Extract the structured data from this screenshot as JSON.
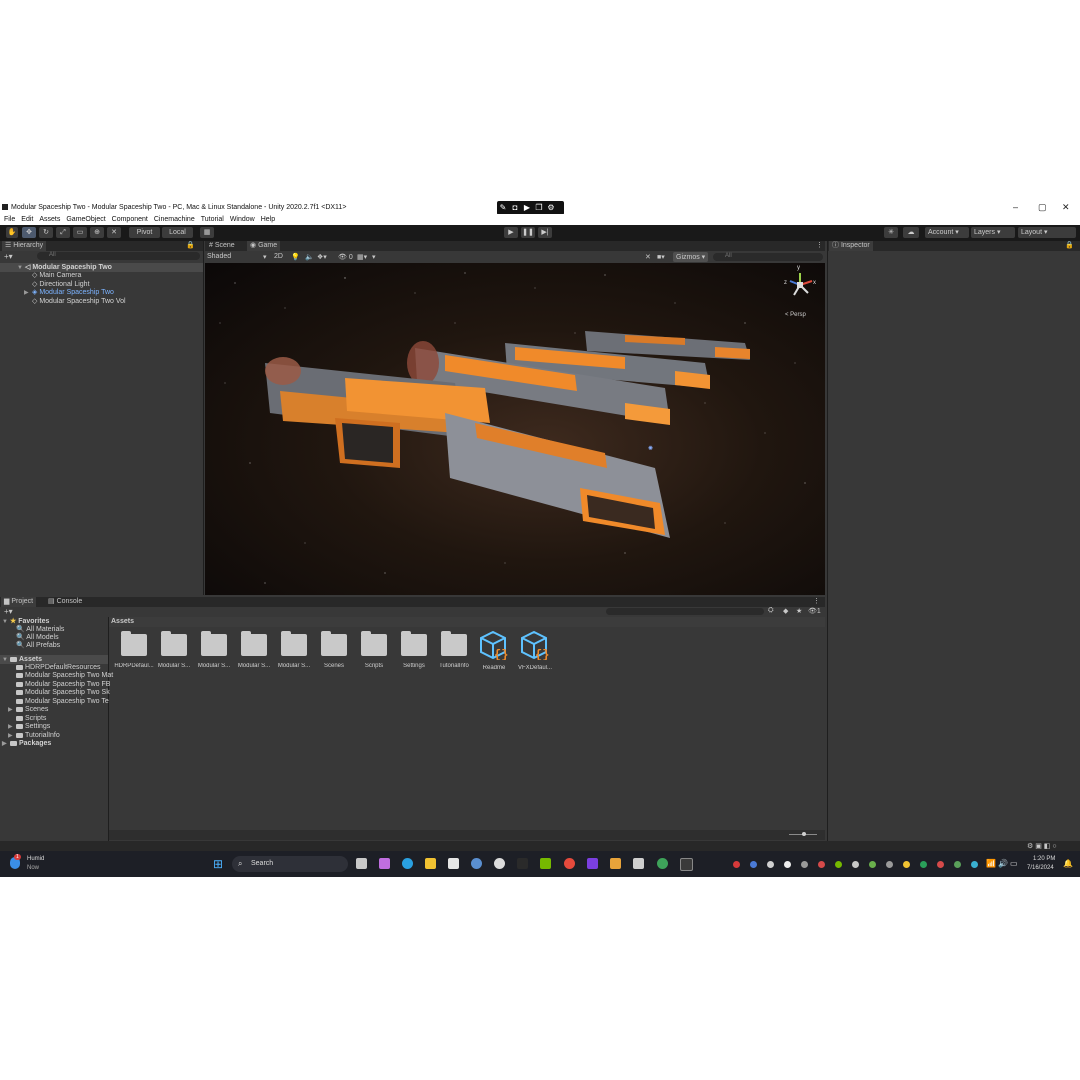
{
  "titlebar": {
    "title": "Modular Spaceship Two - Modular Spaceship Two - PC, Mac & Linux Standalone - Unity 2020.2.7f1 <DX11>"
  },
  "capture_bar": {
    "icons": [
      "pen-icon",
      "camera-icon",
      "video-icon",
      "copy-icon",
      "settings-icon"
    ]
  },
  "window_controls": {
    "minimize": "–",
    "maximize": "▢",
    "close": "✕"
  },
  "menu": {
    "items": [
      "File",
      "Edit",
      "Assets",
      "GameObject",
      "Component",
      "Cinemachine",
      "Tutorial",
      "Window",
      "Help"
    ]
  },
  "toolbar": {
    "pivot": "Pivot",
    "local": "Local",
    "account": "Account",
    "layers": "Layers",
    "layout": "Layout"
  },
  "hierarchy": {
    "tab": "Hierarchy",
    "search_placeholder": "All",
    "items": [
      {
        "label": "Modular Spaceship Two"
      },
      {
        "label": "Main Camera"
      },
      {
        "label": "Directional Light"
      },
      {
        "label": "Modular Spaceship Two"
      },
      {
        "label": "Modular Spaceship Two Vol"
      }
    ]
  },
  "scene": {
    "tab_scene": "Scene",
    "tab_game": "Game",
    "shading": "Shaded",
    "mode_2d": "2D",
    "hidden_count": "0",
    "gizmos": "Gizmos",
    "search_placeholder": "All",
    "persp": "< Persp",
    "gizmo_axes": {
      "y": "y",
      "x": "x",
      "z": "z"
    }
  },
  "inspector": {
    "tab": "Inspector"
  },
  "project": {
    "tab_project": "Project",
    "tab_console": "Console",
    "badge": "1",
    "breadcrumb": "Assets",
    "favorites": {
      "label": "Favorites",
      "items": [
        "All Materials",
        "All Models",
        "All Prefabs"
      ]
    },
    "assets_root": "Assets",
    "tree": [
      "HDRPDefaultResources",
      "Modular Spaceship Two Mat",
      "Modular Spaceship Two FB",
      "Modular Spaceship Two Sk",
      "Modular Spaceship Two Te",
      "Scenes",
      "Scripts",
      "Settings",
      "TutorialInfo"
    ],
    "packages": "Packages",
    "grid": [
      {
        "label": "HDRPDefaul...",
        "type": "folder"
      },
      {
        "label": "Modular S...",
        "type": "folder"
      },
      {
        "label": "Modular S...",
        "type": "folder"
      },
      {
        "label": "Modular S...",
        "type": "folder"
      },
      {
        "label": "Modular S...",
        "type": "folder"
      },
      {
        "label": "Scenes",
        "type": "folder"
      },
      {
        "label": "Scripts",
        "type": "folder"
      },
      {
        "label": "Settings",
        "type": "folder"
      },
      {
        "label": "TutorialInfo",
        "type": "folder"
      },
      {
        "label": "Readme",
        "type": "asset"
      },
      {
        "label": "VFXDefaul...",
        "type": "asset"
      }
    ]
  },
  "taskbar": {
    "user_name": "Humid",
    "user_status": "Now",
    "notification_count": "1",
    "search_placeholder": "Search",
    "time": "1:20 PM",
    "date": "7/16/2024"
  },
  "colors": {
    "editor_bg": "#383838",
    "toolbar_bg": "#191919",
    "accent_blue": "#7cb3ff",
    "engine_orange": "#f08a2a",
    "hull_gray": "#8a8e96"
  }
}
